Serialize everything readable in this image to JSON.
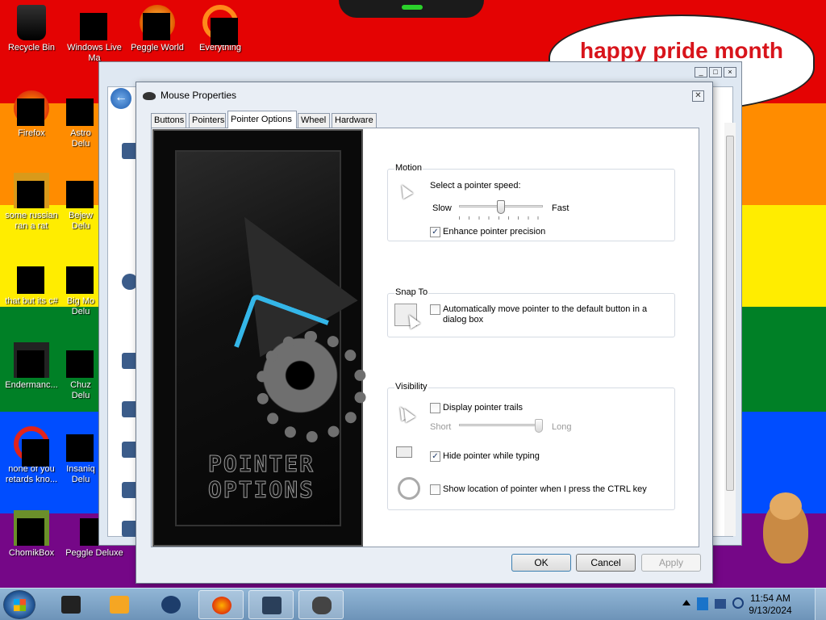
{
  "desktop": {
    "banner_text": "happy pride month",
    "icons": [
      {
        "label": "Recycle Bin"
      },
      {
        "label": "Windows Live Ma"
      },
      {
        "label": "Peggle World"
      },
      {
        "label": "Everything"
      },
      {
        "label": "Firefox"
      },
      {
        "label": "Astro Delu"
      },
      {
        "label": "some russian ran a rat"
      },
      {
        "label": "Bejew Delu"
      },
      {
        "label": "that but its c#"
      },
      {
        "label": "Big Mo Delu"
      },
      {
        "label": "Endermanc..."
      },
      {
        "label": "Chuz Delu"
      },
      {
        "label": "none of you retards kno..."
      },
      {
        "label": "Insaniq Delu"
      },
      {
        "label": "ChomikBox"
      },
      {
        "label": "Peggle Deluxe"
      }
    ]
  },
  "dialog": {
    "title": "Mouse Properties",
    "close_label": "✕",
    "tabs": [
      {
        "label": "Buttons"
      },
      {
        "label": "Pointers"
      },
      {
        "label": "Pointer Options",
        "active": true
      },
      {
        "label": "Wheel"
      },
      {
        "label": "Hardware"
      }
    ],
    "art_text_line1": "POINTER",
    "art_text_line2": "OPTIONS",
    "motion": {
      "title": "Motion",
      "speed_label": "Select a pointer speed:",
      "slow_label": "Slow",
      "fast_label": "Fast",
      "speed_value_fraction": 0.5,
      "enhance_label": "Enhance pointer precision",
      "enhance_checked": true
    },
    "snap_to": {
      "title": "Snap To",
      "auto_move_label_line1": "Automatically move pointer to the default button in a",
      "auto_move_label_line2": "dialog box",
      "auto_move_checked": false
    },
    "visibility": {
      "title": "Visibility",
      "trails_label": "Display pointer trails",
      "trails_checked": false,
      "short_label": "Short",
      "long_label": "Long",
      "trails_value_fraction": 1.0,
      "hide_typing_label": "Hide pointer while typing",
      "hide_typing_checked": true,
      "show_location_label": "Show location of pointer when I press the CTRL key",
      "show_location_checked": false
    },
    "buttons": {
      "ok": "OK",
      "cancel": "Cancel",
      "apply": "Apply"
    }
  },
  "taskbar": {
    "time": "11:54 AM",
    "date": "9/13/2024"
  },
  "colors": {
    "accent": "#3c7fb1",
    "pride_red": "#e40303",
    "pride_orange": "#ff8c00",
    "pride_yellow": "#ffed00",
    "pride_green": "#008026",
    "pride_blue": "#004dff",
    "pride_purple": "#750787"
  }
}
